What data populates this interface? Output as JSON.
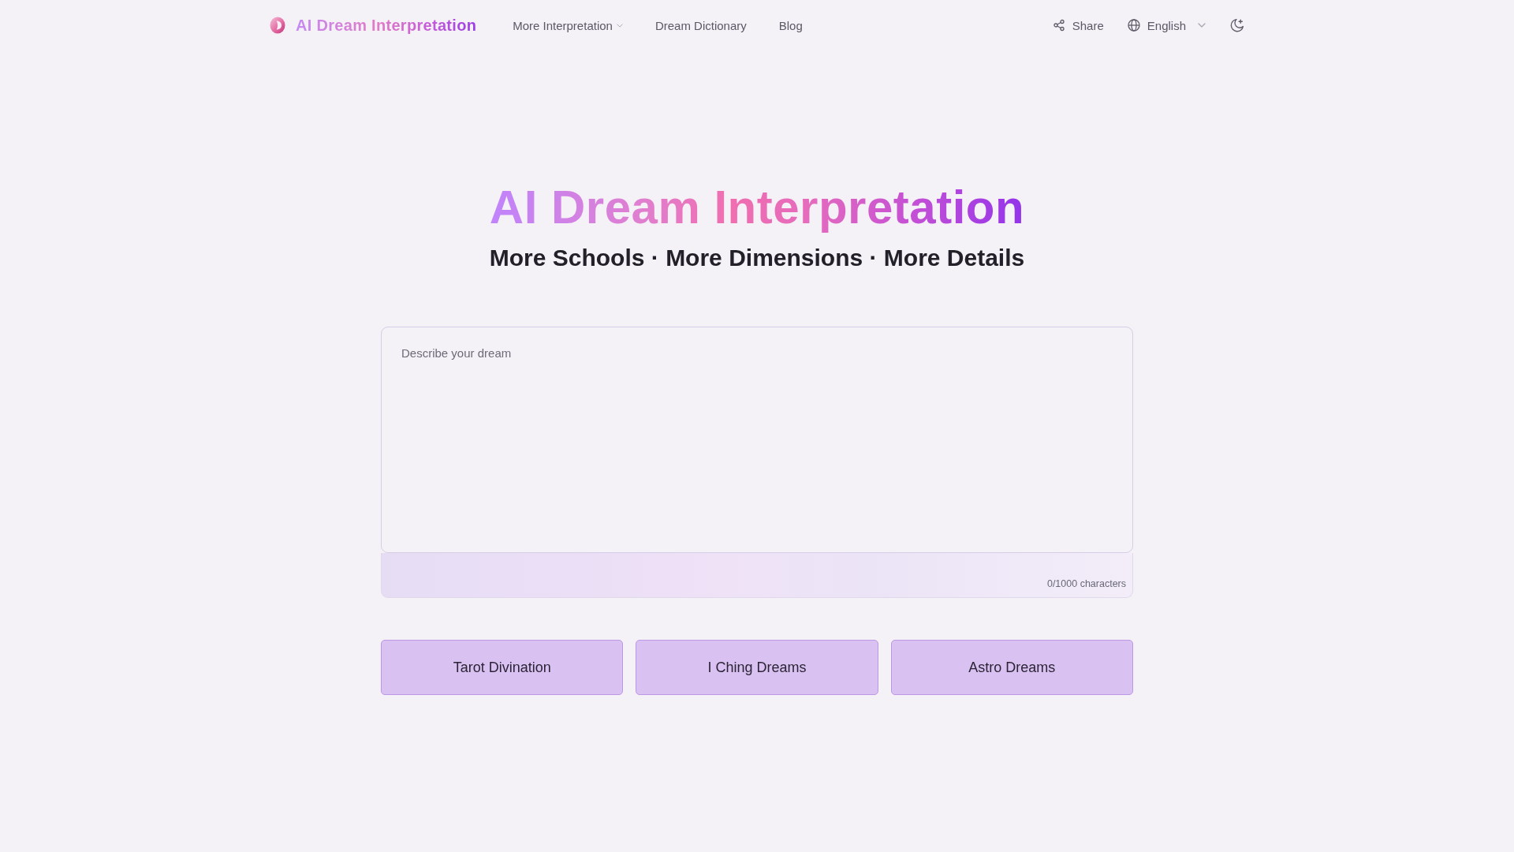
{
  "header": {
    "brand": "AI Dream Interpretation",
    "nav": [
      {
        "label": "More Interpretation",
        "has_menu": true
      },
      {
        "label": "Dream Dictionary",
        "has_menu": false
      },
      {
        "label": "Blog",
        "has_menu": false
      }
    ],
    "share": "Share",
    "language": "English"
  },
  "hero": {
    "title": "AI Dream Interpretation",
    "subtitle": "More Schools · More Dimensions · More Details"
  },
  "dream_input": {
    "placeholder": "Describe your dream",
    "counter": "0/1000 characters"
  },
  "buttons": [
    "Tarot Divination",
    "I Ching Dreams",
    "Astro Dreams"
  ]
}
